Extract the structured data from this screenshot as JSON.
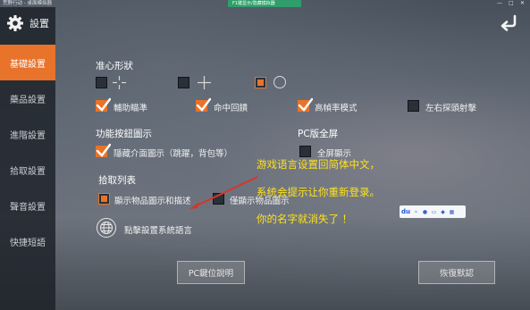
{
  "window": {
    "title": "荒野行动 - 桌面模拟器",
    "tip": "F1键显示/隐藏模拟器",
    "controls": [
      "—",
      "□",
      "✕"
    ]
  },
  "sidebar": {
    "title": "設置",
    "items": [
      {
        "label": "基礎設置",
        "active": true
      },
      {
        "label": "藥品設置",
        "active": false
      },
      {
        "label": "進階設置",
        "active": false
      },
      {
        "label": "拾取設置",
        "active": false
      },
      {
        "label": "聲音設置",
        "active": false
      },
      {
        "label": "快捷短語",
        "active": false
      }
    ]
  },
  "crosshair": {
    "title": "准心形狀"
  },
  "aim_options": [
    {
      "label": "輔助瞄準",
      "checked": true
    },
    {
      "label": "命中回饋",
      "checked": true
    },
    {
      "label": "高幀率模式",
      "checked": true
    },
    {
      "label": "左右探頭射擊",
      "checked": false
    }
  ],
  "function_buttons": {
    "title": "功能按鈕圖示",
    "hide_ui_label": "隱藏介面圖示（跳躍，背包等）",
    "hide_ui_checked": true
  },
  "pc_fullscreen": {
    "title": "PC版全屏",
    "label": "全屏顯示",
    "checked": false
  },
  "pickup_list": {
    "title": "拾取列表",
    "option1_label": "顯示物品圖示和描述",
    "option2_label": "僅顯示物品圖示"
  },
  "language": {
    "label": "點擊設置系統語言"
  },
  "buttons": {
    "pc_keys": "PC鍵位說明",
    "restore_default": "恢復默認"
  },
  "overlay_note": {
    "line1": "游戏语言设置回简体中文，",
    "line2": "系统会提示让你重新登录。",
    "line3": "你的名字就消失了 ！"
  },
  "ime_bar": {
    "brand": "du"
  },
  "colors": {
    "accent": "#e8732a",
    "overlay_text": "#ffe21a",
    "tip_green": "#2f9e6a"
  }
}
